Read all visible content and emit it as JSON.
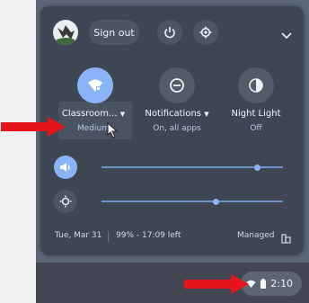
{
  "header": {
    "sign_out_label": "Sign out"
  },
  "tiles": {
    "network": {
      "label": "Classroom...",
      "sub": "Medium"
    },
    "notifications": {
      "label": "Notifications",
      "sub": "On, all apps"
    },
    "night_light": {
      "label": "Night Light",
      "sub": "Off"
    }
  },
  "sliders": {
    "volume_level": 0.86,
    "brightness_level": 0.63
  },
  "footer": {
    "date": "Tue, Mar 31",
    "battery": "99% - 17:09 left",
    "managed": "Managed"
  },
  "shelf": {
    "time": "2:10"
  },
  "colors": {
    "accent": "#8ab4f8",
    "annotation_arrow": "#e8141b",
    "panel": "#3e4654"
  }
}
